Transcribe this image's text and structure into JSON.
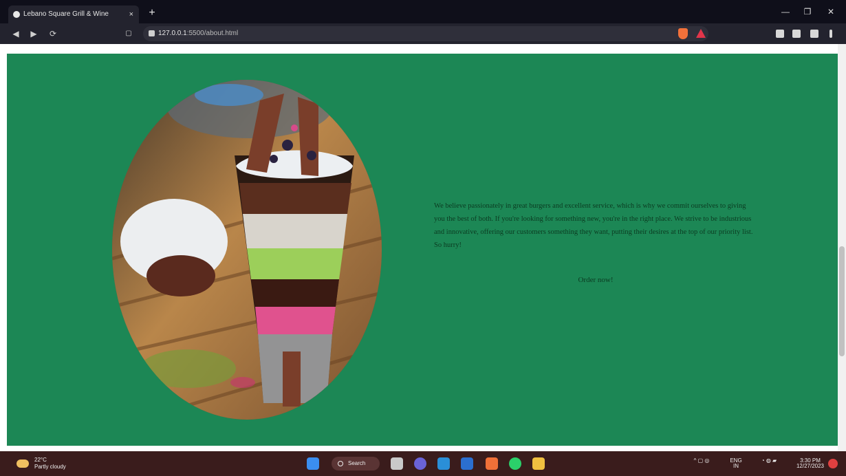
{
  "browser": {
    "tab_title": "Lebano Square Grill & Wine",
    "tab_close": "×",
    "new_tab": "+",
    "url_host": "127.0.0.1",
    "url_path": ":5500/about.html",
    "window_minimize": "—",
    "window_restore": "❐",
    "window_close": "✕",
    "nav_back": "◀",
    "nav_forward": "▶",
    "nav_reload": "⟳"
  },
  "about": {
    "paragraph": "We believe passionately in great burgers and excellent service, which is why we commit ourselves to giving you the best of both. If you're looking for something new, you're in the right place. We strive to be industrious and innovative, offering our customers something they want, putting their desires at the top of our priority list. So hurry!",
    "order_link": "Order now!",
    "image_alt": "Chocolate ice cream dessert with wafer bars",
    "bg_color": "#1c8755"
  },
  "taskbar": {
    "weather_temp": "22°C",
    "weather_desc": "Partly cloudy",
    "search_label": "Search",
    "lang_top": "ENG",
    "lang_bottom": "IN",
    "time": "3:30 PM",
    "date": "12/27/2023"
  }
}
